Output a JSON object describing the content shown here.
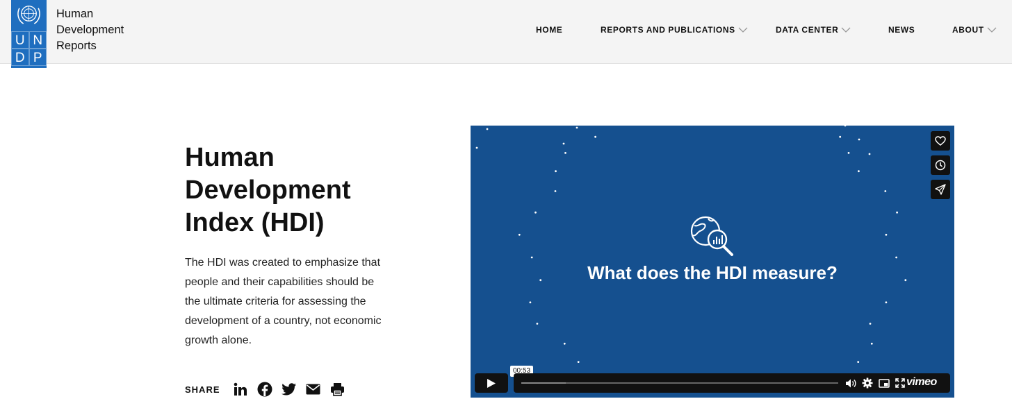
{
  "site": {
    "name_lines": [
      "Human",
      "Development",
      "Reports"
    ],
    "logo_letters": [
      "U",
      "N",
      "D",
      "P"
    ]
  },
  "nav": {
    "items": [
      {
        "label": "HOME",
        "has_dropdown": false
      },
      {
        "label": "REPORTS AND PUBLICATIONS",
        "has_dropdown": true
      },
      {
        "label": "DATA CENTER",
        "has_dropdown": true
      },
      {
        "label": "NEWS",
        "has_dropdown": false
      },
      {
        "label": "ABOUT",
        "has_dropdown": true
      }
    ]
  },
  "main": {
    "title": "Human Development Index (HDI)",
    "description": "The HDI was created to emphasize that people and their capabilities should be the ultimate criteria for assessing the development of a country, not economic growth alone.",
    "share": {
      "label": "SHARE",
      "icons": [
        "linkedin-icon",
        "facebook-icon",
        "twitter-icon",
        "email-icon",
        "print-icon"
      ]
    }
  },
  "video": {
    "heading": "What does the HDI measure?",
    "timecode": "00:53",
    "progress": 0.14,
    "brand": "vimeo",
    "side_actions": [
      "like-icon",
      "watch-later-icon",
      "share-icon"
    ],
    "controls": [
      "volume-icon",
      "settings-icon",
      "pip-icon",
      "fullscreen-icon"
    ]
  },
  "colors": {
    "brand_blue": "#1f6ebf",
    "video_background": "#15508f",
    "header_background": "#f4f4f4"
  }
}
